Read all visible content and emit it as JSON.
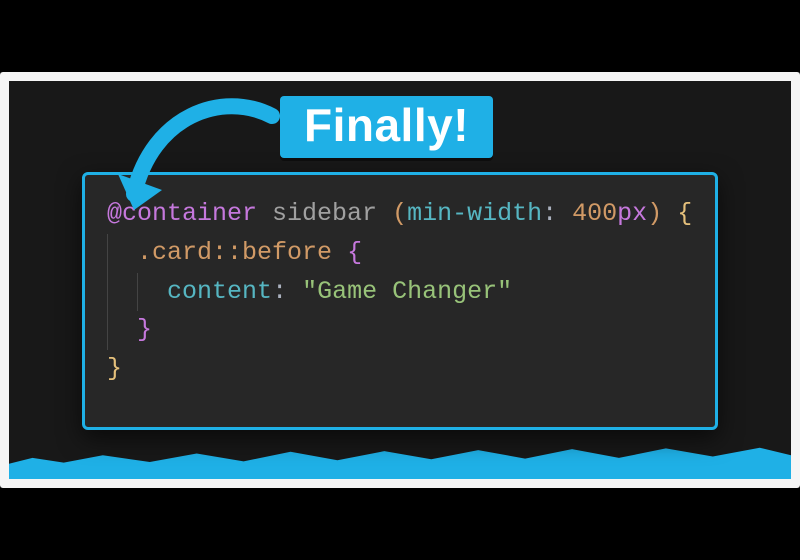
{
  "badge_text": "Finally!",
  "colors": {
    "accent": "#1fb0e6",
    "panel_bg": "#272727",
    "stage_bg": "#181818"
  },
  "code": {
    "atrule": "@container",
    "container_name": "sidebar",
    "condition_prop": "min-width",
    "condition_value": "400",
    "condition_unit": "px",
    "selector_class": ".card",
    "pseudo": "::before",
    "property": "content",
    "string_value": "\"Game Changer\""
  }
}
